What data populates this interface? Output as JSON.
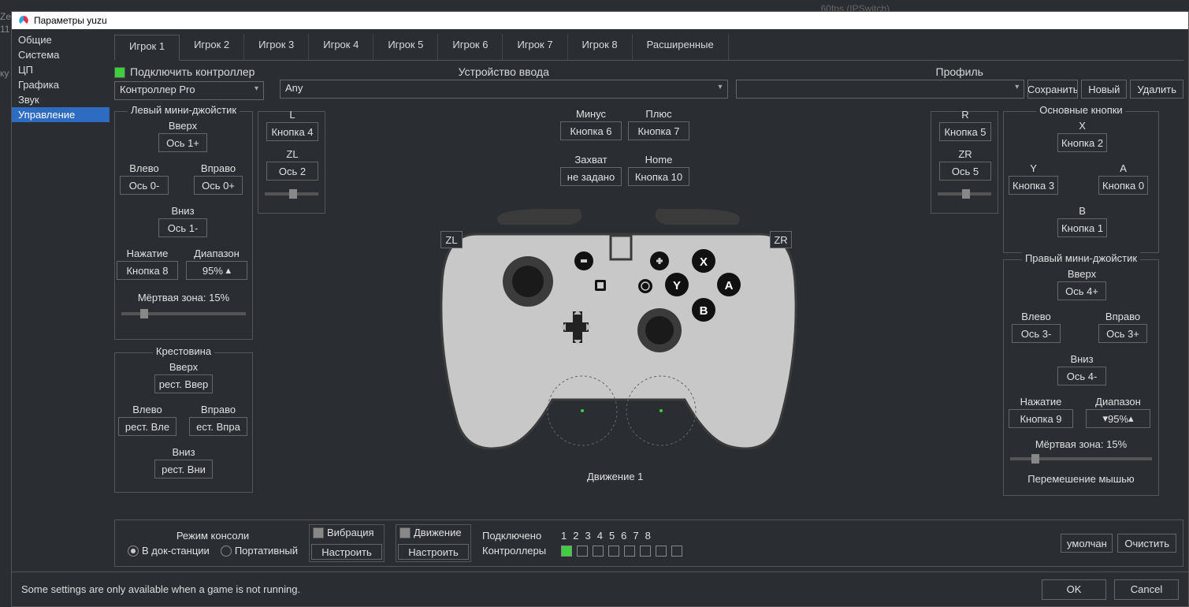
{
  "bg_hint": "60fps (IPSwitch)",
  "left_edge_1": "Ze",
  "left_edge_2": "11",
  "left_edge_3": "ку",
  "window_title": "Параметры yuzu",
  "sidebar": [
    "Общие",
    "Система",
    "ЦП",
    "Графика",
    "Звук",
    "Управление"
  ],
  "sidebar_selected": 5,
  "tabs": [
    "Игрок 1",
    "Игрок 2",
    "Игрок 3",
    "Игрок 4",
    "Игрок 5",
    "Игрок 6",
    "Игрок 7",
    "Игрок 8",
    "Расширенные"
  ],
  "connect_label": "Подключить контроллер",
  "connect_value": "Контроллер Pro",
  "input_device_label": "Устройство ввода",
  "input_device_value": "Any",
  "profile_label": "Профиль",
  "profile_value": "",
  "profile_buttons": {
    "save": "Сохранить",
    "new": "Новый",
    "delete": "Удалить"
  },
  "left_stick": {
    "title": "Левый мини-джойстик",
    "up_l": "Вверх",
    "up_v": "Ось 1+",
    "left_l": "Влево",
    "left_v": "Ось 0-",
    "right_l": "Вправо",
    "right_v": "Ось 0+",
    "down_l": "Вниз",
    "down_v": "Ось 1-",
    "press_l": "Нажатие",
    "press_v": "Кнопка 8",
    "range_l": "Диапазон",
    "range_v": "95%",
    "dead_l": "Мёртвая зона: 15%"
  },
  "dpad": {
    "title": "Крестовина",
    "up_l": "Вверх",
    "up_v": "рест. Ввер",
    "left_l": "Влево",
    "left_v": "рест. Вле",
    "right_l": "Вправо",
    "right_v": "ест. Впра",
    "down_l": "Вниз",
    "down_v": "рест. Вни"
  },
  "lz": {
    "l_l": "L",
    "l_v": "Кнопка 4",
    "zl_l": "ZL",
    "zl_v": "Ось 2"
  },
  "minus": {
    "l": "Минус",
    "v": "Кнопка 6"
  },
  "plus": {
    "l": "Плюс",
    "v": "Кнопка 7"
  },
  "capture": {
    "l": "Захват",
    "v": "не задано"
  },
  "home": {
    "l": "Home",
    "v": "Кнопка 10"
  },
  "rz": {
    "r_l": "R",
    "r_v": "Кнопка 5",
    "zr_l": "ZR",
    "zr_v": "Ось 5"
  },
  "face": {
    "title": "Основные кнопки",
    "x_l": "X",
    "x_v": "Кнопка 2",
    "y_l": "Y",
    "y_v": "Кнопка 3",
    "a_l": "A",
    "a_v": "Кнопка 0",
    "b_l": "B",
    "b_v": "Кнопка 1"
  },
  "right_stick": {
    "title": "Правый мини-джойстик",
    "up_l": "Вверх",
    "up_v": "Ось 4+",
    "left_l": "Влево",
    "left_v": "Ось 3-",
    "right_l": "Вправо",
    "right_v": "Ось 3+",
    "down_l": "Вниз",
    "down_v": "Ось 4-",
    "press_l": "Нажатие",
    "press_v": "Кнопка 9",
    "range_l": "Диапазон",
    "range_v": "95%",
    "dead_l": "Мёртвая зона: 15%",
    "mouse_l": "Перемешение мышью"
  },
  "motion_label": "Движение 1",
  "console_mode": {
    "title": "Режим консоли",
    "dock": "В док-станции",
    "hand": "Портативный"
  },
  "vibration": {
    "l": "Вибрация",
    "btn": "Настроить"
  },
  "motion": {
    "l": "Движение",
    "btn": "Настроить"
  },
  "connected_l": "Подключено",
  "controllers_l": "Контроллеры",
  "nums": [
    "1",
    "2",
    "3",
    "4",
    "5",
    "6",
    "7",
    "8"
  ],
  "defaults_btn": "умолчан",
  "clear_btn": "Очистить",
  "bottom_msg": "Some settings are only available when a game is not running.",
  "ok": "OK",
  "cancel": "Cancel",
  "zl_tag": "ZL",
  "zr_tag": "ZR"
}
